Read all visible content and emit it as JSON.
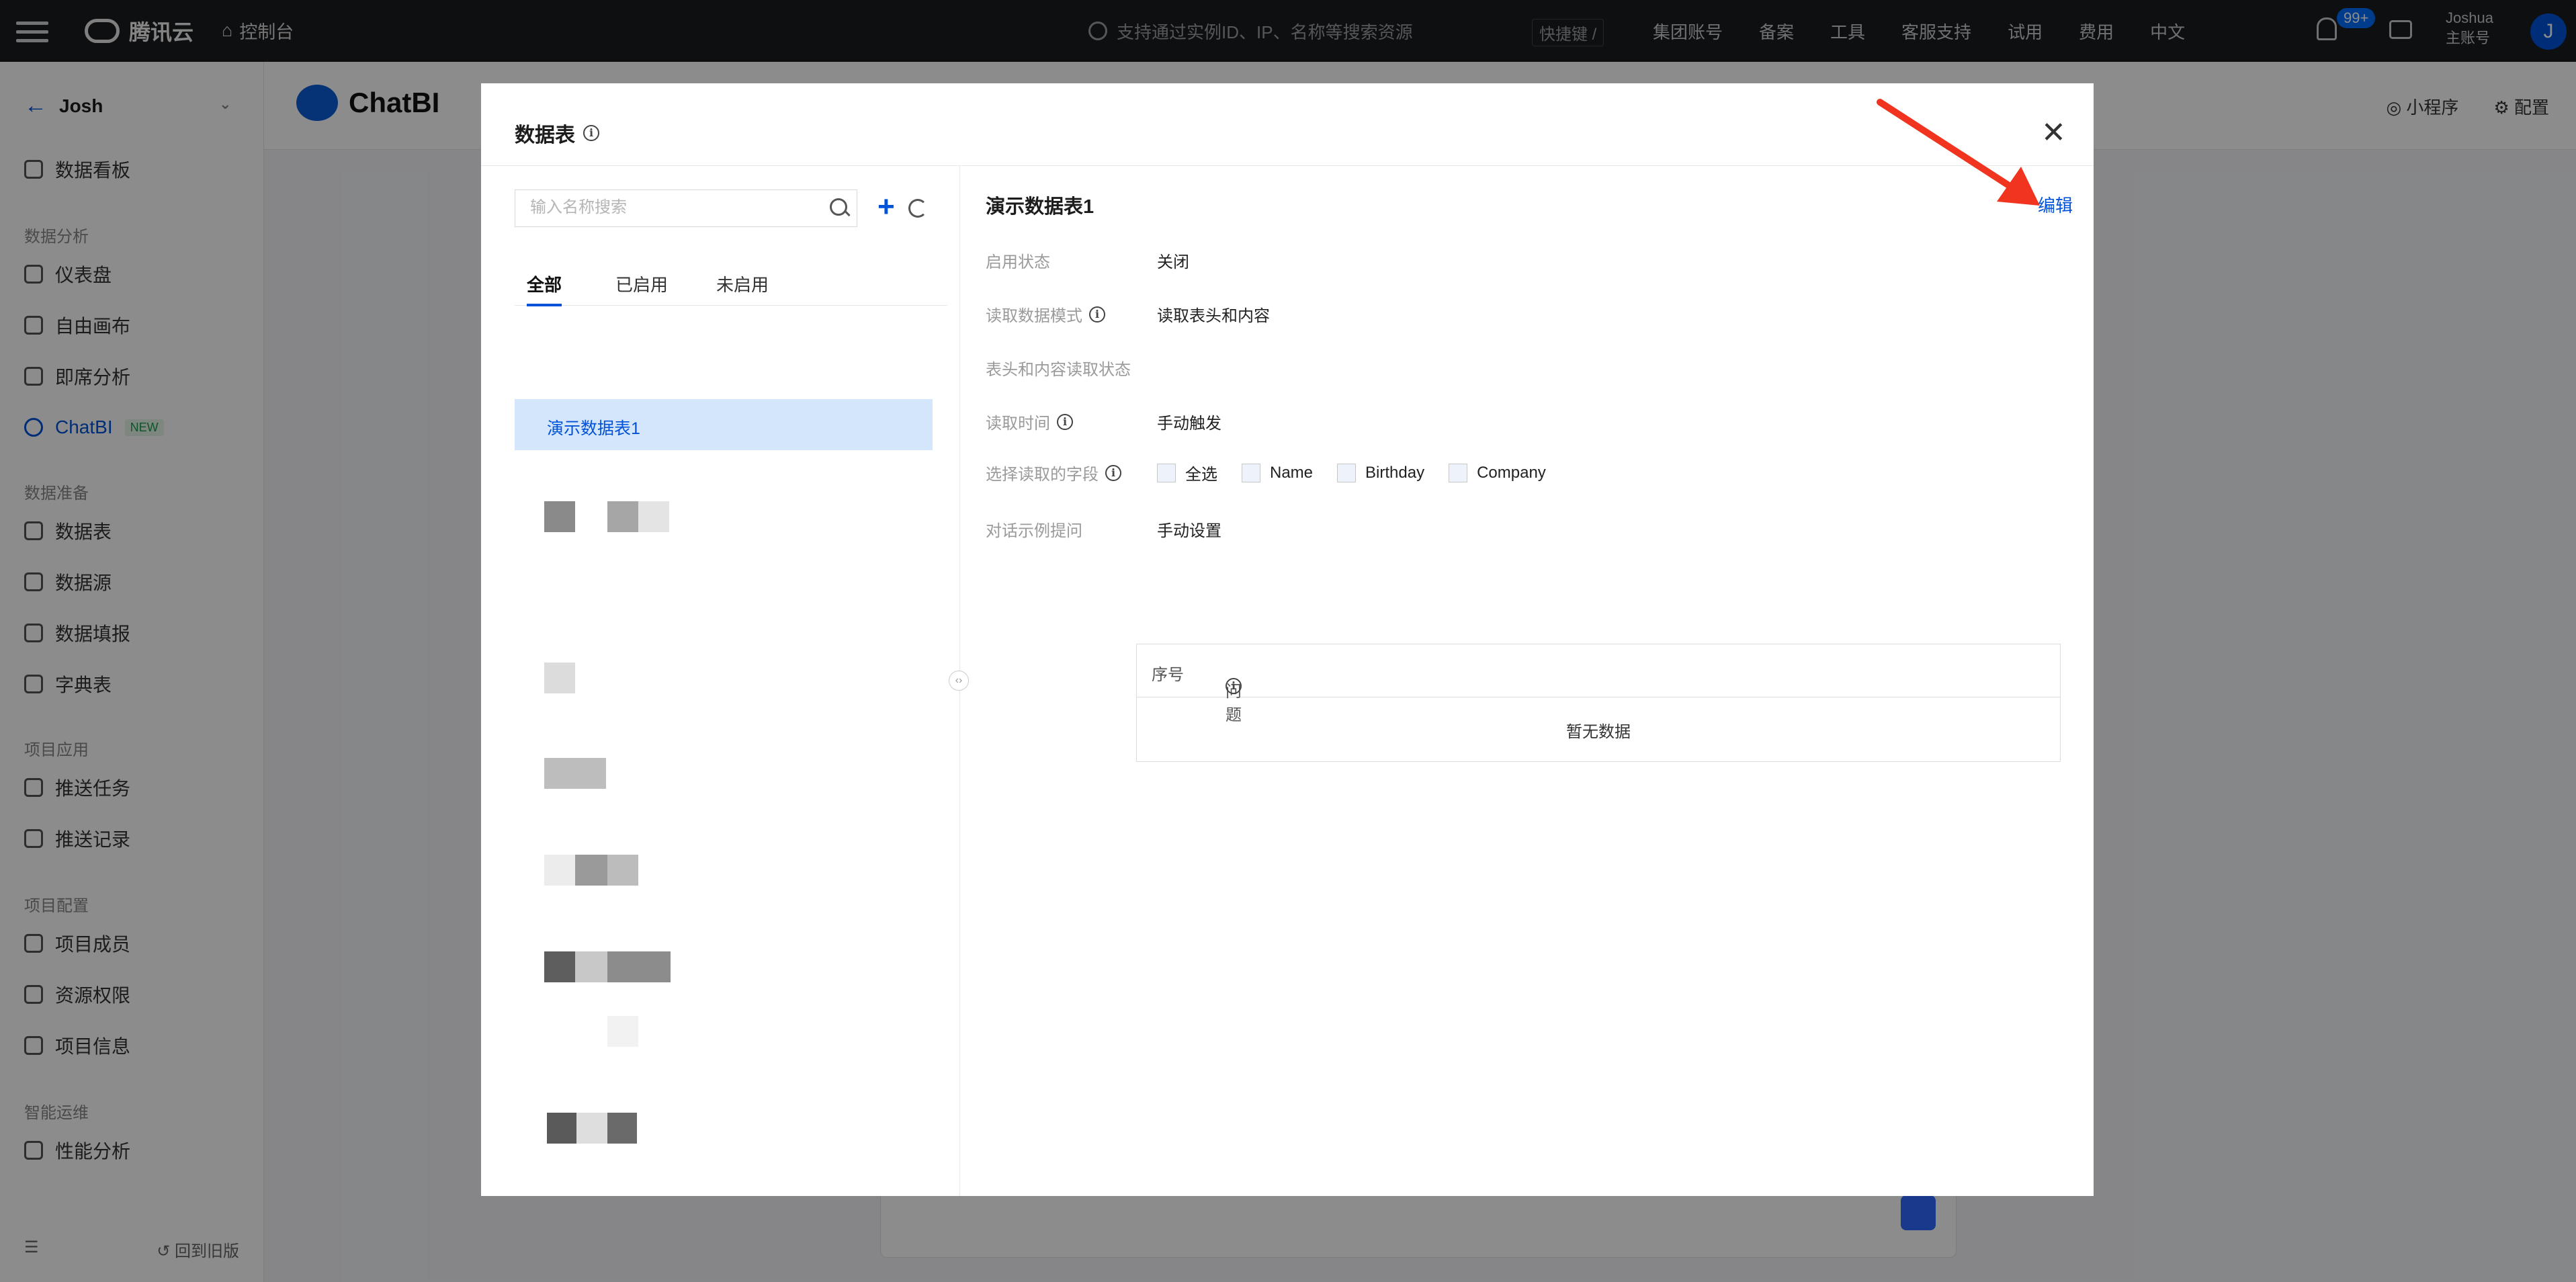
{
  "topbar": {
    "brand": "腾讯云",
    "console": "控制台",
    "search_placeholder": "支持通过实例ID、IP、名称等搜索资源",
    "shortcut": "快捷键 /",
    "menu": [
      "集团账号",
      "备案",
      "工具",
      "客服支持",
      "试用",
      "费用",
      "中文"
    ],
    "badge": "99+",
    "user_name": "Joshua",
    "user_role": "主账号",
    "avatar": "J"
  },
  "sidebar": {
    "project": "Josh",
    "groups": {
      "analysis": "数据分析",
      "prep": "数据准备",
      "app": "项目应用",
      "config": "项目配置",
      "ops": "智能运维"
    },
    "items": {
      "dashboard_board": "数据看板",
      "dashboard": "仪表盘",
      "canvas": "自由画布",
      "adhoc": "即席分析",
      "chatbi": "ChatBI",
      "datatable": "数据表",
      "datasource": "数据源",
      "datafill": "数据填报",
      "dictionary": "字典表",
      "push_task": "推送任务",
      "push_log": "推送记录",
      "members": "项目成员",
      "permissions": "资源权限",
      "project_info": "项目信息",
      "performance": "性能分析"
    },
    "new_tag": "NEW",
    "back_old": "回到旧版"
  },
  "mainhead": {
    "brand": "ChatBI",
    "miniprogram": "小程序",
    "config": "配置"
  },
  "modal": {
    "title": "数据表",
    "search_placeholder": "输入名称搜索",
    "tabs": [
      "全部",
      "已启用",
      "未启用"
    ],
    "selected_item": "演示数据表1",
    "detail": {
      "title": "演示数据表1",
      "edit": "编辑",
      "status_label": "启用状态",
      "status_value": "关闭",
      "mode_label": "读取数据模式",
      "mode_value": "读取表头和内容",
      "read_status_label": "表头和内容读取状态",
      "time_label": "读取时间",
      "time_value": "手动触发",
      "fields_label": "选择读取的字段",
      "fields": [
        "全选",
        "Name",
        "Birthday",
        "Company"
      ],
      "examples_label": "对话示例提问",
      "examples_value": "手动设置",
      "table_col_index": "序号",
      "table_col_question": "问题",
      "empty": "暂无数据"
    }
  },
  "colors": {
    "accent": "#0052d9",
    "selected_row": "#d4e6fb",
    "annotation_arrow": "#f0341f"
  }
}
